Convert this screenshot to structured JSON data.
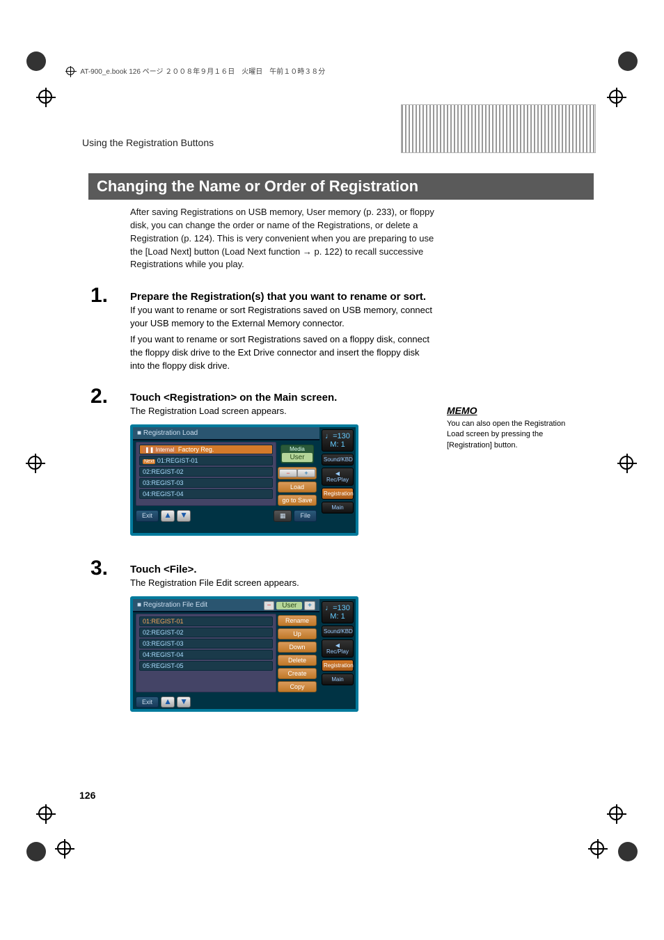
{
  "header_runner": "AT-900_e.book  126 ページ  ２００８年９月１６日　火曜日　午前１０時３８分",
  "section": "Using the Registration Buttons",
  "title": "Changing the Name or Order of Registration",
  "intro": "After saving Registrations on USB memory, User memory (p. 233), or floppy disk, you can change the order or name of the Registrations, or delete a Registration (p. 124). This is very convenient when you are preparing to use the [Load Next] button (Load Next function → p. 122) to recall successive Registrations while you play.",
  "steps": {
    "s1": {
      "num": "1.",
      "title": "Prepare the Registration(s) that you want to rename or sort.",
      "body1": "If you want to rename or sort Registrations saved on USB memory, connect your USB memory to the External Memory connector.",
      "body2": "If you want to rename or sort Registrations saved on a floppy disk, connect the floppy disk drive to the Ext Drive connector and insert the floppy disk into the floppy disk drive."
    },
    "s2": {
      "num": "2.",
      "title": "Touch <Registration> on the Main screen.",
      "body": "The Registration Load screen appears."
    },
    "s3": {
      "num": "3.",
      "title": "Touch <File>.",
      "body": "The Registration File Edit screen appears."
    }
  },
  "memo": {
    "label": "MEMO",
    "text": "You can also open the Registration Load screen by pressing the [Registration] button."
  },
  "screen1": {
    "title": "Registration Load",
    "internal": "Internal",
    "factory": "Factory Reg.",
    "media": "Media",
    "user": "User",
    "items": {
      "i1": "01:REGIST-01",
      "i2": "02:REGIST-02",
      "i3": "03:REGIST-03",
      "i4": "04:REGIST-04"
    },
    "next": "Next",
    "load": "Load",
    "save": "go to Save",
    "exit": "Exit",
    "file": "File",
    "up_icon": "▲",
    "down_icon": "▼",
    "minus": "−",
    "plus": "+"
  },
  "screen2": {
    "title": "Registration File Edit",
    "user": "User",
    "items": {
      "i1": "01:REGIST-01",
      "i2": "02:REGIST-02",
      "i3": "03:REGIST-03",
      "i4": "04:REGIST-04",
      "i5": "05:REGIST-05"
    },
    "rename": "Rename",
    "up": "Up",
    "down": "Down",
    "delete": "Delete",
    "create": "Create",
    "copy": "Copy",
    "exit": "Exit",
    "minus": "−",
    "plus": "+",
    "up_icon": "▲",
    "down_icon": "▼"
  },
  "sidebar": {
    "tempo": "♩=130",
    "measure": "M:   1",
    "soundkbd": "Sound/KBD",
    "recplay": "Rec/Play",
    "registration": "Registration",
    "main": "Main"
  },
  "page_num": "126"
}
